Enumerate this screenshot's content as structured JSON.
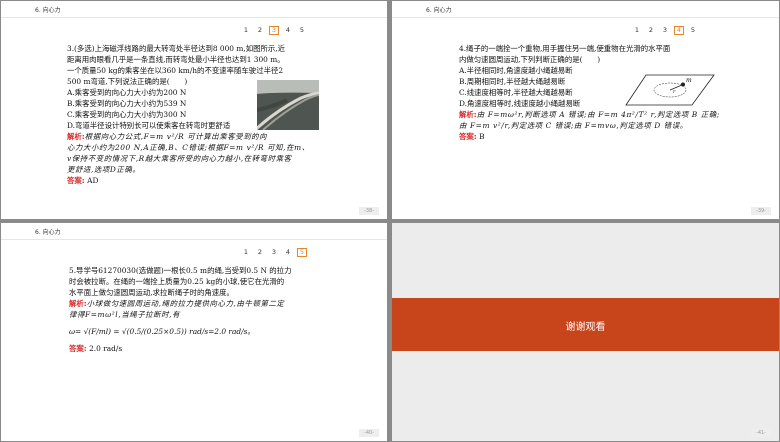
{
  "header_section": "6. 向心力",
  "pager_numbers": [
    "1",
    "2",
    "3",
    "4",
    "5"
  ],
  "slide1": {
    "active_page": "3",
    "page_number": "-38-",
    "lines": [
      "3.(多选)上海磁浮线路的最大转弯处半径达到8 000 m,如图所示,近",
      "距离用肉眼看几乎是一条直线,而转弯处最小半径也达到1 300 m。",
      "一个质量50 kg的乘客坐在以360 km/h的不变速率随车驶过半径2",
      "500 m弯道,下列说法正确的是(　　)",
      "A.乘客受到的向心力大小约为200 N",
      "B.乘客受到的向心力大小约为539 N",
      "C.乘客受到的向心力大小约为300 N",
      "D.弯道半径设计特别长可以使乘客在转弯时更舒适"
    ],
    "analysis_label": "解析:",
    "analysis_lines": [
      "根据向心力公式,F=m v²/R 可计算出乘客受到的向",
      "心力大小约为200 N,A正确,B、C错误;根据F=m v²/R 可知,在m、",
      "v保持不变的情况下,R越大乘客所受的向心力越小,在转弯时乘客",
      "更舒适,选项D正确。"
    ],
    "answer_label": "答案:",
    "answer": "AD"
  },
  "slide2": {
    "active_page": "4",
    "page_number": "-39-",
    "lines": [
      "4.绳子的一端拴一个重物,用手握住另一端,使重物在光滑的水平面",
      "内做匀速圆周运动,下列判断正确的是(　　)",
      "A.半径相同时,角速度越小绳越易断",
      "B.周期相同时,半径越大绳越易断",
      "C.线速度相等时,半径越大绳越易断",
      "D.角速度相等时,线速度越小绳越易断"
    ],
    "figure_label_m": "m",
    "figure_label_r": "r",
    "analysis_label": "解析:",
    "analysis_lines": [
      "由 F=mω²r,判断选项 A 错误;由 F=m 4π²/T² r,判定选项 B 正确;",
      "由 F=m v²/r,判定选项 C 错误;由 F=mvω,判定选项 D 错误。"
    ],
    "answer_label": "答案:",
    "answer": "B"
  },
  "slide3": {
    "active_page": "5",
    "page_number": "-40-",
    "lines": [
      "5.导学号61270030(选做题)一根长0.5 m的绳,当受到0.5 N 的拉力",
      "时会被拉断。在绳的一端拴上质量为0.25 kg的小球,使它在光滑的",
      "水平面上做匀速圆周运动,求拉断绳子时的角速度。"
    ],
    "analysis_label": "解析:",
    "analysis_lines": [
      "小球做匀速圆周运动,绳的拉力提供向心力,由牛顿第二定",
      "律得F=mω²l,当绳子拉断时,有"
    ],
    "formula": "ω= √(F/ml) = √(0.5/(0.25×0.5)) rad/s=2.0 rad/s。",
    "answer_label": "答案:",
    "answer": "2.0 rad/s"
  },
  "slide4": {
    "thanks": "谢谢观看",
    "page_number": "-41-"
  }
}
